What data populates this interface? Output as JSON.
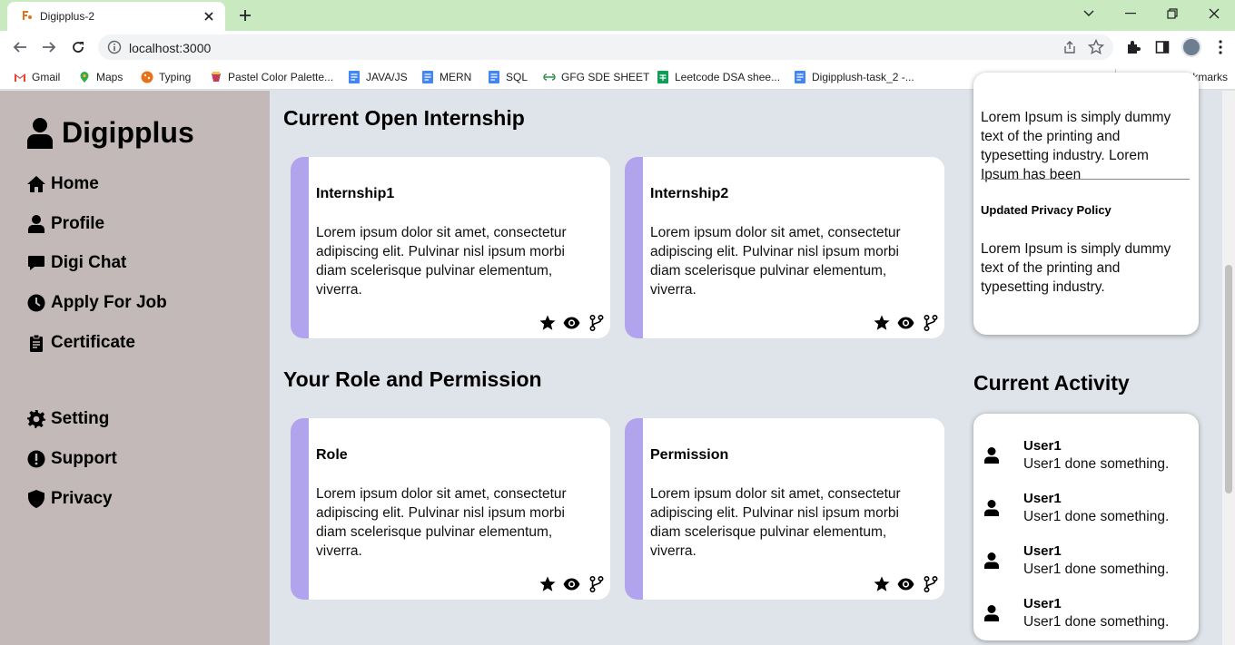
{
  "browser": {
    "tab_title": "Digipplus-2",
    "url": "localhost:3000",
    "bookmarks": [
      {
        "label": "Gmail",
        "icon": "gmail-icon",
        "color": "#ea4335"
      },
      {
        "label": "Maps",
        "icon": "maps-icon",
        "color": "#34a853"
      },
      {
        "label": "Typing",
        "icon": "typing-icon",
        "color": "#e8711a"
      },
      {
        "label": "Pastel Color Palette...",
        "icon": "palette-icon",
        "color": "#c43b5c"
      },
      {
        "label": "JAVA/JS",
        "icon": "doc-icon",
        "color": "#4285f4"
      },
      {
        "label": "MERN",
        "icon": "doc-icon",
        "color": "#4285f4"
      },
      {
        "label": "SQL",
        "icon": "doc-icon",
        "color": "#4285f4"
      },
      {
        "label": "GFG SDE SHEET",
        "icon": "gfg-icon",
        "color": "#2f8d46"
      },
      {
        "label": "Leetcode DSA shee...",
        "icon": "sheet-icon",
        "color": "#0f9d58"
      },
      {
        "label": "Digipplush-task_2 -...",
        "icon": "doc-icon",
        "color": "#4285f4"
      }
    ],
    "other_bookmarks": "Other bookmarks"
  },
  "sidebar": {
    "brand": "Digipplus",
    "items": [
      {
        "label": "Home",
        "icon": "home-icon"
      },
      {
        "label": "Profile",
        "icon": "user-icon"
      },
      {
        "label": "Digi Chat",
        "icon": "chat-icon"
      },
      {
        "label": "Apply For Job",
        "icon": "clock-icon"
      },
      {
        "label": "Certificate",
        "icon": "clipboard-icon"
      },
      {
        "label": "Setting",
        "icon": "gear-icon"
      },
      {
        "label": "Support",
        "icon": "alert-icon"
      },
      {
        "label": "Privacy",
        "icon": "shield-icon"
      }
    ]
  },
  "main": {
    "internships_title": "Current Open Internship",
    "internships": [
      {
        "title": "Internship1",
        "body": "Lorem ipsum dolor sit amet, consectetur adipiscing elit. Pulvinar nisl ipsum morbi diam scelerisque pulvinar elementum, viverra."
      },
      {
        "title": "Internship2",
        "body": "Lorem ipsum dolor sit amet, consectetur adipiscing elit. Pulvinar nisl ipsum morbi diam scelerisque pulvinar elementum, viverra."
      }
    ],
    "roles_title": "Your Role and Permission",
    "roles": [
      {
        "title": "Role",
        "body": "Lorem ipsum dolor sit amet, consectetur adipiscing elit. Pulvinar nisl ipsum morbi diam scelerisque pulvinar elementum, viverra."
      },
      {
        "title": "Permission",
        "body": "Lorem ipsum dolor sit amet, consectetur adipiscing elit. Pulvinar nisl ipsum morbi diam scelerisque pulvinar elementum, viverra."
      }
    ],
    "stripe_color": "#b2a4ec"
  },
  "announcements": {
    "text_1": "Lorem Ipsum is simply dummy text of the printing and typesetting industry. Lorem Ipsum has been",
    "heading_2": "Updated Privacy Policy",
    "text_2": "Lorem Ipsum is simply dummy text of the printing and typesetting industry."
  },
  "activity": {
    "title": "Current Activity",
    "items": [
      {
        "name": "User1",
        "desc": "User1 done something."
      },
      {
        "name": "User1",
        "desc": "User1 done something."
      },
      {
        "name": "User1",
        "desc": "User1 done something."
      },
      {
        "name": "User1",
        "desc": "User1 done something."
      }
    ]
  }
}
